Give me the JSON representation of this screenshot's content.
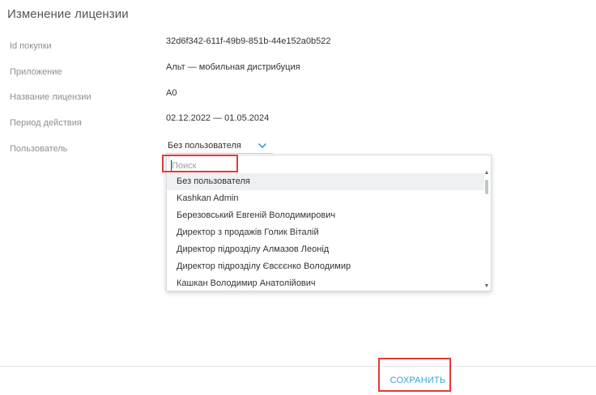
{
  "page": {
    "title": "Изменение лицензии"
  },
  "fields": [
    {
      "label": "Id покупки",
      "value": "32d6f342-611f-49b9-851b-44e152a0b522"
    },
    {
      "label": "Приложение",
      "value": "Альт — мобильная дистрибуция"
    },
    {
      "label": "Название лицензии",
      "value": "А0"
    },
    {
      "label": "Период действия",
      "value": "02.12.2022 — 01.05.2024"
    },
    {
      "label": "Пользователь"
    }
  ],
  "user_select": {
    "selected": "Без пользователя",
    "search_placeholder": "Поиск",
    "options": [
      "Без пользователя",
      "Kashkan Admin",
      "Березовський Евгеній Володимирович",
      "Директор з продажів Голик Віталій",
      "Директор підрозділу Алмазов Леонід",
      "Директор підрозділу Євсєєнко Володимир",
      "Кашкан Володимир Анатолійович"
    ]
  },
  "footer": {
    "save_label": "СОХРАНИТЬ"
  },
  "colors": {
    "accent": "#3aa0d8",
    "highlight": "#e53935"
  }
}
